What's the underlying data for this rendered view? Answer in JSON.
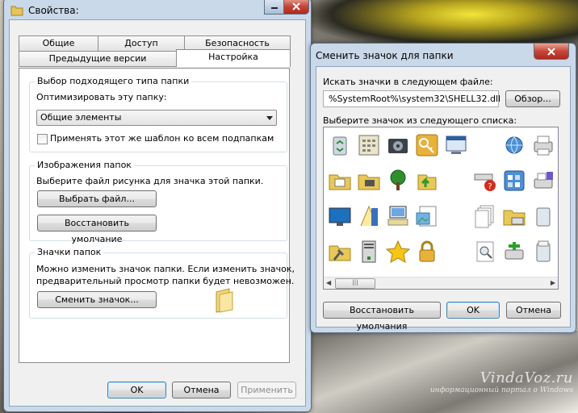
{
  "background": {
    "watermark_site": "VindaVoz.ru",
    "watermark_caption": "информационный портал о Windows"
  },
  "props_window": {
    "title": "Свойства:",
    "tabs": [
      "Общие",
      "Доступ",
      "Безопасность",
      "Предыдущие версии",
      "Настройка"
    ],
    "active_tab": "Настройка",
    "group_type": {
      "legend": "Выбор подходящего типа папки",
      "optimize_label": "Оптимизировать эту папку:",
      "select_value": "Общие элементы",
      "apply_template_label": "Применять этот же шаблон ко всем подпапкам",
      "apply_template_checked": false
    },
    "group_pictures": {
      "legend": "Изображения папок",
      "hint": "Выберите файл рисунка для значка этой папки.",
      "choose_file": "Выбрать файл...",
      "restore_default": "Восстановить умолчание"
    },
    "group_icons": {
      "legend": "Значки папок",
      "desc_line1": "Можно изменить значок папки. Если изменить значок,",
      "desc_line2": "предварительный просмотр папки будет невозможен.",
      "change_icon": "Сменить значок..."
    },
    "buttons": {
      "ok": "OK",
      "cancel": "Отмена",
      "apply": "Применить"
    }
  },
  "change_icon_dialog": {
    "title": "Сменить значок для папки",
    "search_label": "Искать значки в следующем файле:",
    "file_path": "%SystemRoot%\\system32\\SHELL32.dll",
    "browse": "Обзор...",
    "list_label": "Выберите значок из следующего списка:",
    "selected_icon_index": 12,
    "icons": [
      "recycle-bin-icon",
      "calculator-window-icon",
      "media-drive-icon",
      "keys-icon",
      "computer-window-icon",
      "",
      "network-globe-icon",
      "printer-icon",
      "folder-doc-icon",
      "folder-disk-icon",
      "tree-icon",
      "folder-arrow-icon",
      "",
      "network-error-icon",
      "control-panel-icon",
      "printer-fax-icon",
      "monitor-icon",
      "font-icon",
      "computer-icon",
      "image-document-icon",
      "blank-selected",
      "documents-icon",
      "folder-printer-icon",
      "recycle-bin-empty-icon",
      "folder-tools-icon",
      "server-icon",
      "star-icon",
      "lock-icon",
      "",
      "search-document-icon",
      "network-printer-icon",
      "recycle-bin-full-icon"
    ],
    "restore_defaults": "Восстановить умолчания",
    "ok": "OK",
    "cancel": "Отмена"
  }
}
